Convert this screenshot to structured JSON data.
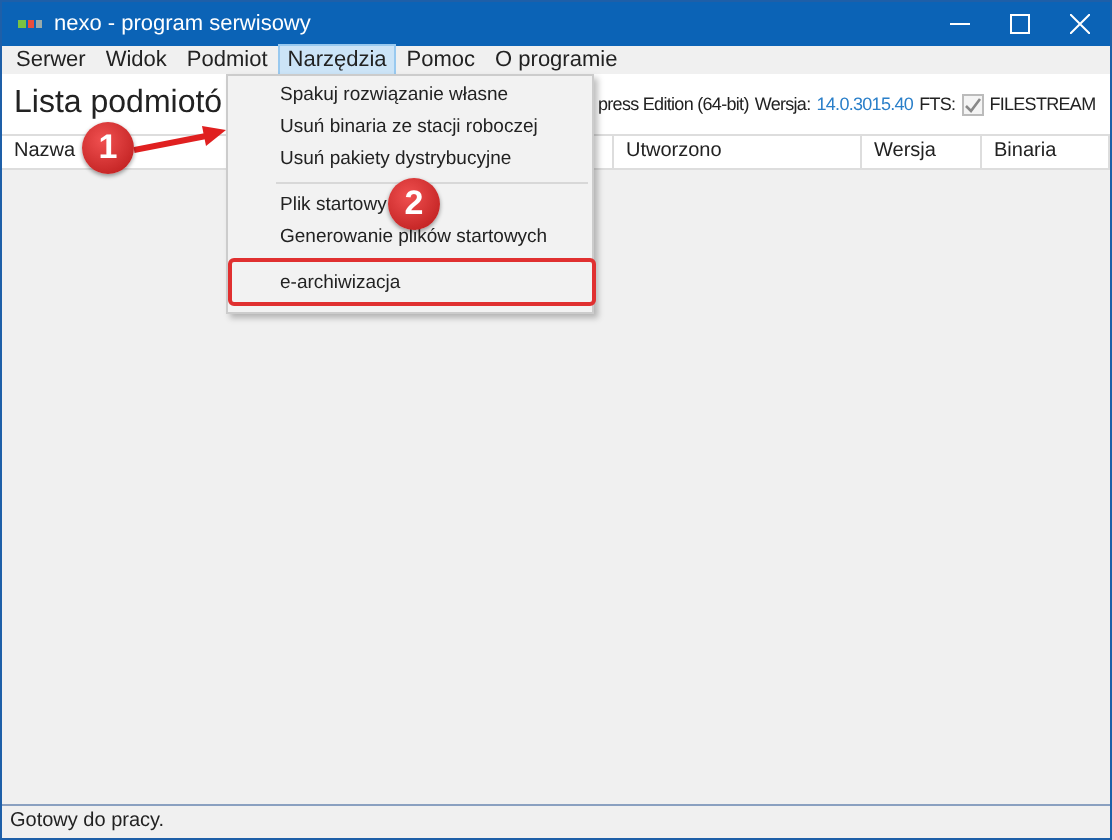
{
  "window": {
    "title": "nexo - program serwisowy"
  },
  "menu_bar": [
    {
      "label": "Serwer",
      "selected": false
    },
    {
      "label": "Widok",
      "selected": false
    },
    {
      "label": "Podmiot",
      "selected": false
    },
    {
      "label": "Narzędzia",
      "selected": true
    },
    {
      "label": "Pomoc",
      "selected": false
    },
    {
      "label": "O programie",
      "selected": false
    }
  ],
  "heading": "Lista podmiotó",
  "server_info": {
    "edition": "press Edition (64-bit)",
    "version_label": "Wersja:",
    "version": "14.0.3015.40",
    "fts_label": "FTS:",
    "fts_checked": true,
    "filestream": "FILESTREAM"
  },
  "table": {
    "columns": [
      "Nazwa",
      "Utworzono",
      "Wersja",
      "Binaria"
    ]
  },
  "dropdown": {
    "items": [
      {
        "kind": "item",
        "label": "Spakuj rozwiązanie własne",
        "marked": false
      },
      {
        "kind": "item",
        "label": "Usuń binaria ze stacji roboczej",
        "marked": false
      },
      {
        "kind": "item",
        "label": "Usuń pakiety dystrybucyjne",
        "marked": false
      },
      {
        "kind": "separator"
      },
      {
        "kind": "item",
        "label": "Plik startowy",
        "marked": false
      },
      {
        "kind": "item",
        "label": "Generowanie plików startowych",
        "marked": false
      },
      {
        "kind": "separator"
      },
      {
        "kind": "item",
        "label": "e-archiwizacja",
        "marked": true
      }
    ]
  },
  "annotations": [
    {
      "kind": "badge",
      "label": "1"
    },
    {
      "kind": "arrow"
    },
    {
      "kind": "badge",
      "label": "2"
    }
  ],
  "status_bar": "Gotowy do pracy."
}
